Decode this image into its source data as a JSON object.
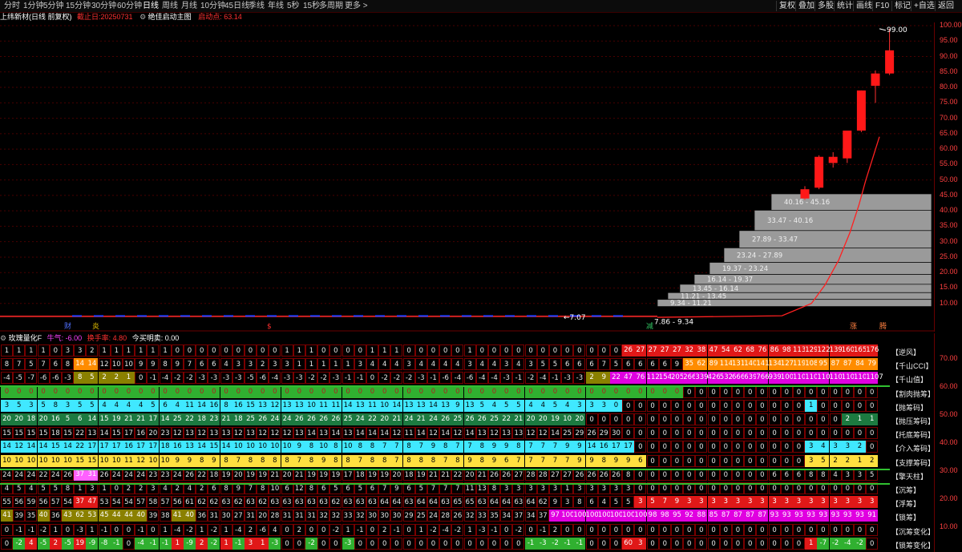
{
  "toolbar": {
    "periods": [
      "分时",
      "1分钟",
      "5分钟",
      "15分钟",
      "30分钟",
      "60分钟",
      "日线",
      "周线",
      "月线",
      "10分钟",
      "45日线",
      "季线",
      "年线",
      "5秒",
      "15秒",
      "多周期",
      "更多 >"
    ],
    "active": "日线",
    "right": [
      "复权",
      "叠加",
      "多股",
      "统计",
      "画线",
      "F10",
      "标记",
      "+自选",
      "返回"
    ]
  },
  "info": {
    "stock": "上纬新材(日线 前复权)",
    "deadline": "截止日:20250731",
    "indicator": "绝佳启动主图",
    "start": "启动点: 63.14"
  },
  "sub": {
    "name": "玫瑰量化F",
    "qi": "牛气: -6.00",
    "turnover": "换手率: 4.80",
    "today": "今买明卖: 0.00"
  },
  "yaxis_main": [
    "100.00",
    "95.00",
    "90.00",
    "85.00",
    "80.00",
    "75.00",
    "70.00",
    "65.00",
    "60.00",
    "55.00",
    "50.00",
    "45.00",
    "40.00",
    "35.00",
    "30.00",
    "25.00",
    "20.00",
    "15.00",
    "10.00"
  ],
  "yaxis_sub": [
    "70.00",
    "60.00",
    "50.00",
    "40.00",
    "30.00",
    "20.00",
    "10.00"
  ],
  "annotations": {
    "high": "99.00",
    "low_left": "7.07",
    "low_right": "7.86 - 9.34",
    "markers": [
      "财",
      "炎",
      "$",
      "减",
      "涨",
      "腾"
    ]
  },
  "ranges": [
    "40.16 - 45.16",
    "33.47 - 40.16",
    "27.89 - 33.47",
    "23.24 - 27.89",
    "19.37 - 23.24",
    "16.14 - 19.37",
    "13.45 - 16.14",
    "11.21 - 13.45",
    "9.34 - 11.21"
  ],
  "legend": [
    "【逆风】",
    "【千山CCI】",
    "【千山值】",
    "【割肉抛筹】",
    "【抛筹码】",
    "【抛压筹码】",
    "【托底筹码】",
    "【介入筹码】",
    "【支撑筹码】",
    "【擎天柱】",
    "【沉筹】",
    "【浮筹】",
    "【锁筹】",
    "【沉筹变化】",
    "【锁筹变化】"
  ],
  "colors": {
    "up": "#ff2020",
    "down": "#00e0ff",
    "grid": "#5a0000",
    "text": "#c8c8c8",
    "cyan": "#40e8ff",
    "yellow": "#ffe040",
    "green": "#1c7a40",
    "orange": "#ff8c00",
    "magenta": "#e000e0",
    "lime": "#30b030",
    "red": "#e01818",
    "olive": "#8a8000",
    "pink": "#ff60ff"
  },
  "chart_data": {
    "type": "candlestick",
    "ylim": [
      5,
      100
    ],
    "candles": [
      {
        "o": 44.0,
        "h": 48.0,
        "l": 43.5,
        "c": 47.0
      },
      {
        "o": 47.5,
        "h": 58.0,
        "l": 47.0,
        "c": 57.5
      },
      {
        "o": 55.5,
        "h": 59.0,
        "l": 54.0,
        "c": 57.5
      },
      {
        "o": 57.0,
        "h": 66.0,
        "l": 55.5,
        "c": 66.0
      },
      {
        "o": 66.0,
        "h": 79.0,
        "l": 65.5,
        "c": 79.0
      },
      {
        "o": 80.5,
        "h": 85.5,
        "l": 75.0,
        "c": 84.5
      },
      {
        "o": 84.5,
        "h": 99.0,
        "l": 84.0,
        "c": 92.0
      }
    ],
    "ma": [
      [
        0,
        5.5
      ],
      [
        0.55,
        6
      ],
      [
        0.68,
        10
      ],
      [
        0.74,
        16
      ],
      [
        0.8,
        24
      ],
      [
        0.85,
        33
      ],
      [
        0.89,
        42
      ],
      [
        0.92,
        50
      ],
      [
        0.95,
        57
      ],
      [
        0.98,
        64
      ]
    ]
  },
  "grid": {
    "r1": [
      "1",
      "1",
      "1",
      "1",
      "0",
      "3",
      "3",
      "2",
      "1",
      "1",
      "1",
      "1",
      "1",
      "1",
      "0",
      "0",
      "0",
      "0",
      "0",
      "0",
      "0",
      "0",
      "0",
      "1",
      "1",
      "1",
      "0",
      "0",
      "0",
      "0",
      "1",
      "1",
      "1",
      "0",
      "0",
      "0",
      "0",
      "0",
      "1",
      "0",
      "0",
      "0",
      "0",
      "0",
      "0",
      "0",
      "0",
      "0",
      "0",
      "0",
      "0",
      "26",
      "27",
      "27",
      "27",
      "27",
      "32",
      "38",
      "47",
      "54",
      "62",
      "68",
      "76",
      "86",
      "98",
      "113",
      "129",
      "122",
      "139",
      "160",
      "165",
      "176"
    ],
    "r2": [
      "8",
      "7",
      "5",
      "7",
      "6",
      "8",
      "14",
      "14",
      "12",
      "10",
      "10",
      "9",
      "9",
      "8",
      "9",
      "7",
      "6",
      "6",
      "4",
      "3",
      "3",
      "2",
      "3",
      "3",
      "1",
      "1",
      "1",
      "1",
      "1",
      "3",
      "4",
      "4",
      "4",
      "3",
      "4",
      "4",
      "4",
      "4",
      "3",
      "4",
      "4",
      "3",
      "4",
      "3",
      "5",
      "5",
      "6",
      "6",
      "6",
      "7",
      "5",
      "6",
      "6",
      "6",
      "6",
      "9",
      "35",
      "62",
      "89",
      "114",
      "131",
      "140",
      "141",
      "134",
      "127",
      "119",
      "108",
      "95",
      "87",
      "87",
      "84",
      "79"
    ],
    "r3": [
      "-4",
      "-5",
      "-7",
      "-6",
      "-6",
      "-3",
      "8",
      "5",
      "2",
      "2",
      "1",
      "0",
      "-1",
      "-4",
      "-2",
      "-2",
      "-3",
      "-3",
      "-3",
      "-3",
      "-5",
      "-6",
      "-4",
      "-3",
      "-3",
      "-2",
      "-2",
      "-3",
      "-1",
      "-1",
      "0",
      "-2",
      "-2",
      "-2",
      "-3",
      "-1",
      "-6",
      "-4",
      "-6",
      "-4",
      "-4",
      "-3",
      "-1",
      "-2",
      "-4",
      "-1",
      "-3",
      "-3",
      "2",
      "9",
      "22",
      "47",
      "76",
      "112",
      "154",
      "205",
      "266",
      "339",
      "426",
      "532",
      "666",
      "639",
      "766",
      "939",
      "1003",
      "1107",
      "1107",
      "1107",
      "1107",
      "1107",
      "1107",
      "1107"
    ],
    "r4": [
      "0",
      "0",
      "0",
      "0",
      "0",
      "0",
      "0",
      "0",
      "0",
      "0",
      "0",
      "0",
      "0",
      "0",
      "0",
      "0",
      "0",
      "0",
      "0",
      "0",
      "0",
      "0",
      "0",
      "0",
      "0",
      "0",
      "0",
      "0",
      "0",
      "0",
      "0",
      "0",
      "0",
      "0",
      "0",
      "0",
      "0",
      "0",
      "0",
      "0",
      "0",
      "0",
      "0",
      "0",
      "0",
      "0",
      "0",
      "0",
      "0",
      "0",
      "0",
      "0",
      "0",
      "0",
      "0",
      "0",
      "0",
      "0",
      "0",
      "0",
      "0",
      "0",
      "0",
      "0",
      "0",
      "0",
      "0",
      "0",
      "0",
      "0",
      "0",
      "0"
    ],
    "r5": [
      "3",
      "5",
      "3",
      "5",
      "8",
      "3",
      "5",
      "5",
      "4",
      "4",
      "4",
      "4",
      "5",
      "6",
      "4",
      "11",
      "14",
      "16",
      "8",
      "16",
      "15",
      "13",
      "12",
      "13",
      "13",
      "10",
      "11",
      "11",
      "14",
      "13",
      "11",
      "10",
      "14",
      "13",
      "13",
      "14",
      "13",
      "9",
      "13",
      "5",
      "4",
      "5",
      "5",
      "4",
      "4",
      "5",
      "4",
      "3",
      "3",
      "3",
      "0",
      "0",
      "0",
      "0",
      "0",
      "0",
      "0",
      "0",
      "0",
      "0",
      "0",
      "0",
      "0",
      "0",
      "0",
      "0",
      "1",
      "0",
      "0",
      "0",
      "0",
      "0"
    ],
    "r6": [
      "20",
      "20",
      "18",
      "20",
      "16",
      "5",
      "6",
      "14",
      "15",
      "19",
      "21",
      "21",
      "17",
      "14",
      "25",
      "22",
      "18",
      "23",
      "21",
      "18",
      "25",
      "26",
      "24",
      "24",
      "26",
      "26",
      "26",
      "26",
      "25",
      "24",
      "22",
      "20",
      "21",
      "24",
      "21",
      "24",
      "26",
      "25",
      "26",
      "26",
      "25",
      "22",
      "21",
      "20",
      "20",
      "19",
      "10",
      "20",
      "0",
      "0",
      "0",
      "0",
      "0",
      "0",
      "0",
      "0",
      "0",
      "0",
      "0",
      "0",
      "0",
      "0",
      "0",
      "0",
      "0",
      "0",
      "0",
      "0",
      "0",
      "2",
      "1",
      "1"
    ],
    "r7": [
      "15",
      "15",
      "15",
      "15",
      "18",
      "15",
      "22",
      "13",
      "14",
      "15",
      "17",
      "16",
      "20",
      "23",
      "12",
      "13",
      "12",
      "13",
      "13",
      "12",
      "13",
      "12",
      "12",
      "12",
      "13",
      "14",
      "13",
      "14",
      "13",
      "14",
      "14",
      "14",
      "12",
      "11",
      "14",
      "12",
      "14",
      "12",
      "14",
      "13",
      "12",
      "13",
      "13",
      "12",
      "12",
      "14",
      "25",
      "29",
      "26",
      "29",
      "30",
      "0",
      "0",
      "0",
      "0",
      "0",
      "0",
      "0",
      "0",
      "0",
      "0",
      "0",
      "0",
      "0",
      "0",
      "0",
      "0",
      "0",
      "0",
      "0",
      "0",
      "0"
    ],
    "r8": [
      "14",
      "12",
      "14",
      "14",
      "15",
      "14",
      "22",
      "17",
      "17",
      "17",
      "16",
      "17",
      "17",
      "18",
      "16",
      "13",
      "14",
      "15",
      "14",
      "10",
      "10",
      "10",
      "10",
      "10",
      "9",
      "8",
      "10",
      "8",
      "10",
      "8",
      "8",
      "7",
      "7",
      "8",
      "7",
      "9",
      "8",
      "7",
      "7",
      "8",
      "9",
      "9",
      "8",
      "7",
      "7",
      "7",
      "9",
      "9",
      "14",
      "16",
      "17",
      "17",
      "0",
      "0",
      "0",
      "0",
      "0",
      "0",
      "0",
      "0",
      "0",
      "0",
      "0",
      "0",
      "0",
      "0",
      "3",
      "4",
      "3",
      "3",
      "2",
      "0"
    ],
    "r9": [
      "10",
      "10",
      "10",
      "10",
      "10",
      "10",
      "15",
      "15",
      "10",
      "10",
      "11",
      "12",
      "10",
      "10",
      "9",
      "9",
      "8",
      "9",
      "8",
      "7",
      "8",
      "8",
      "8",
      "8",
      "7",
      "8",
      "9",
      "8",
      "8",
      "7",
      "8",
      "8",
      "7",
      "8",
      "8",
      "8",
      "7",
      "8",
      "9",
      "8",
      "9",
      "6",
      "7",
      "7",
      "7",
      "7",
      "7",
      "9",
      "9",
      "8",
      "9",
      "9",
      "6",
      "0",
      "0",
      "0",
      "0",
      "0",
      "0",
      "0",
      "0",
      "0",
      "0",
      "0",
      "0",
      "0",
      "3",
      "5",
      "2",
      "2",
      "1",
      "2"
    ],
    "r10": [
      "24",
      "24",
      "24",
      "22",
      "24",
      "26",
      "37",
      "31",
      "26",
      "24",
      "24",
      "24",
      "23",
      "23",
      "24",
      "26",
      "22",
      "18",
      "19",
      "20",
      "19",
      "19",
      "21",
      "20",
      "21",
      "19",
      "19",
      "19",
      "17",
      "18",
      "19",
      "19",
      "20",
      "18",
      "19",
      "21",
      "21",
      "22",
      "20",
      "21",
      "26",
      "26",
      "27",
      "28",
      "28",
      "27",
      "27",
      "26",
      "26",
      "26",
      "26",
      "8",
      "0",
      "0",
      "0",
      "0",
      "0",
      "0",
      "0",
      "0",
      "0",
      "0",
      "0",
      "6",
      "6",
      "6",
      "8",
      "8",
      "4",
      "3",
      "3",
      "5"
    ],
    "r11": [
      "4",
      "5",
      "4",
      "5",
      "5",
      "8",
      "1",
      "3",
      "1",
      "0",
      "2",
      "2",
      "3",
      "4",
      "2",
      "4",
      "2",
      "6",
      "8",
      "9",
      "7",
      "8",
      "10",
      "6",
      "12",
      "8",
      "6",
      "5",
      "6",
      "5",
      "6",
      "7",
      "9",
      "6",
      "5",
      "7",
      "7",
      "7",
      "11",
      "13",
      "8",
      "3",
      "3",
      "3",
      "3",
      "3",
      "1",
      "3",
      "3",
      "3",
      "3",
      "3",
      "0",
      "0",
      "0",
      "0",
      "0",
      "0",
      "0",
      "0",
      "0",
      "0",
      "0",
      "0",
      "0",
      "0",
      "0",
      "0",
      "0",
      "0",
      "0",
      "0"
    ],
    "r12": [
      "55",
      "56",
      "59",
      "56",
      "57",
      "54",
      "37",
      "47",
      "53",
      "54",
      "54",
      "57",
      "58",
      "57",
      "56",
      "61",
      "62",
      "62",
      "63",
      "62",
      "63",
      "62",
      "63",
      "63",
      "63",
      "63",
      "63",
      "62",
      "63",
      "63",
      "63",
      "64",
      "64",
      "63",
      "64",
      "64",
      "63",
      "65",
      "65",
      "63",
      "64",
      "64",
      "63",
      "64",
      "62",
      "9",
      "3",
      "8",
      "6",
      "4",
      "5",
      "5",
      "3",
      "5",
      "7",
      "9",
      "3",
      "3",
      "3",
      "3",
      "3",
      "3",
      "3",
      "3",
      "3",
      "3",
      "3",
      "3",
      "3",
      "3",
      "3",
      "3"
    ],
    "r13": [
      "41",
      "39",
      "35",
      "40",
      "36",
      "43",
      "62",
      "53",
      "45",
      "44",
      "44",
      "40",
      "39",
      "38",
      "41",
      "40",
      "36",
      "31",
      "30",
      "27",
      "31",
      "20",
      "28",
      "31",
      "31",
      "31",
      "32",
      "32",
      "33",
      "32",
      "30",
      "30",
      "30",
      "29",
      "25",
      "24",
      "28",
      "26",
      "32",
      "33",
      "35",
      "34",
      "37",
      "34",
      "37",
      "97",
      "100",
      "100",
      "100",
      "100",
      "100",
      "100",
      "100",
      "98",
      "98",
      "95",
      "92",
      "88",
      "85",
      "87",
      "87",
      "87",
      "87",
      "93",
      "93",
      "93",
      "93",
      "93",
      "93",
      "93",
      "93",
      "91"
    ],
    "r14": [
      "0",
      "-1",
      "-1",
      "-2",
      "1",
      "0",
      "-3",
      "1",
      "-1",
      "0",
      "0",
      "-1",
      "0",
      "1",
      "-4",
      "-2",
      "1",
      "-2",
      "1",
      "-4",
      "2",
      "-6",
      "4",
      "0",
      "2",
      "0",
      "0",
      "-2",
      "1",
      "-1",
      "0",
      "2",
      "-1",
      "0",
      "1",
      "-2",
      "-4",
      "-2",
      "1",
      "-3",
      "-1",
      "0",
      "-2",
      "0",
      "-1",
      "2",
      "0",
      "0",
      "0",
      "0",
      "0",
      "0",
      "0",
      "0",
      "0",
      "0",
      "0",
      "0",
      "0",
      "0",
      "0",
      "0",
      "0",
      "0",
      "0",
      "0",
      "0",
      "0",
      "0",
      "0",
      "0",
      "0"
    ],
    "r15": [
      "0",
      "-2",
      "4",
      "-5",
      "2",
      "-5",
      "19",
      "-9",
      "-8",
      "-1",
      "0",
      "-4",
      "-1",
      "-1",
      "1",
      "-9",
      "2",
      "-2",
      "1",
      "-1",
      "3",
      "1",
      "-3",
      "0",
      "0",
      "-2",
      "0",
      "0",
      "-3",
      "0",
      "0",
      "0",
      "0",
      "0",
      "0",
      "0",
      "0",
      "0",
      "0",
      "0",
      "0",
      "0",
      "0",
      "-1",
      "-3",
      "-2",
      "-1",
      "-1",
      "0",
      "0",
      "0",
      "60",
      "3",
      "0",
      "0",
      "0",
      "0",
      "0",
      "0",
      "0",
      "0",
      "0",
      "0",
      "0",
      "0",
      "0",
      "1",
      "-7",
      "-2",
      "-4",
      "-2",
      "0"
    ]
  }
}
